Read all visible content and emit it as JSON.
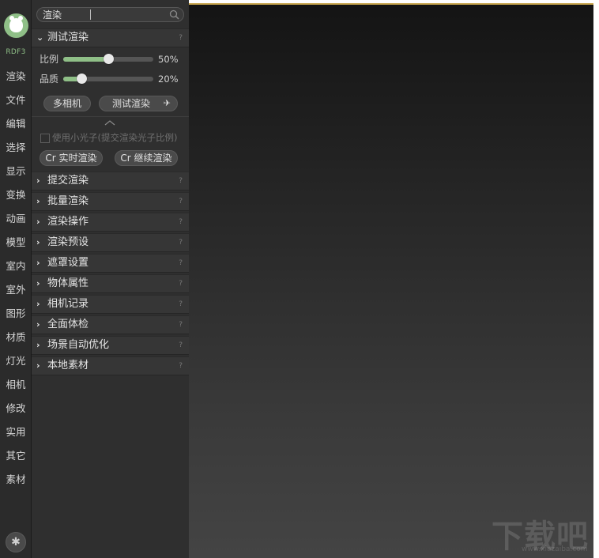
{
  "rail": {
    "version": "RDF3",
    "items": [
      "渲染",
      "文件",
      "编辑",
      "选择",
      "显示",
      "变换",
      "动画",
      "模型",
      "室内",
      "室外",
      "图形",
      "材质",
      "灯光",
      "相机",
      "修改",
      "实用",
      "其它",
      "素材"
    ],
    "logo_icon": "bear-face-icon",
    "settings_icon": "gear-icon"
  },
  "search": {
    "value": "渲染",
    "icon": "search-icon"
  },
  "test_render": {
    "title": "测试渲染",
    "help": "?",
    "scale_label": "比例",
    "scale_value": 0.5,
    "scale_text": "50%",
    "quality_label": "品质",
    "quality_value": 0.2,
    "quality_text": "20%",
    "multi_camera_label": "多相机",
    "test_render_label": "测试渲染",
    "test_render_icon": "airplane-icon",
    "collapse_icon": "chevron-up-icon",
    "use_small_photon_label": "使用小光子(提交渲染光子比例)",
    "realtime_render_label": "Cr 实时渲染",
    "continue_render_label": "Cr 继续渲染"
  },
  "sections": [
    {
      "label": "提交渲染",
      "help": "?"
    },
    {
      "label": "批量渲染",
      "help": "?"
    },
    {
      "label": "渲染操作",
      "help": "?"
    },
    {
      "label": "渲染预设",
      "help": "?"
    },
    {
      "label": "遮罩设置",
      "help": "?"
    },
    {
      "label": "物体属性",
      "help": "?"
    },
    {
      "label": "相机记录",
      "help": "?"
    },
    {
      "label": "全面体检",
      "help": "?"
    },
    {
      "label": "场景自动优化",
      "help": "?"
    },
    {
      "label": "本地素材",
      "help": "?"
    }
  ],
  "watermark": {
    "text": "下载吧",
    "url": "www.xiazaiba.com"
  },
  "colors": {
    "accent": "#8fbf87",
    "viewport_border": "#c7a54d"
  }
}
